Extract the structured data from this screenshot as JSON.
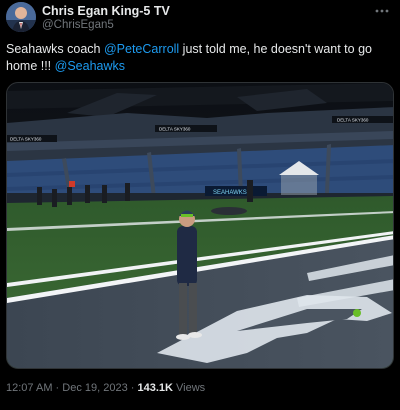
{
  "header": {
    "display_name": "Chris Egan King-5 TV",
    "handle": "@ChrisEgan5",
    "more_icon": "ellipsis-icon"
  },
  "tweet": {
    "text_start": "Seahawks coach ",
    "mention": "@PeteCarroll",
    "text_middle": " just told me, he doesn't want to go home !!! ",
    "hashtag": "@Seahawks"
  },
  "media": {
    "banner_1": "DELTA SKY360",
    "banner_2": "DELTA SKY360",
    "banner_3": "DELTA SKY360",
    "banner_4": "DELTA",
    "sideline_sign": "SEAHAWKS"
  },
  "meta": {
    "time": "12:07 AM",
    "separator": " · ",
    "date": "Dec 19, 2023",
    "views_count": "143.1K",
    "views_label": " Views"
  },
  "colors": {
    "link": "#1d9bf0",
    "muted": "#71767b",
    "text": "#e7e9ea",
    "background": "#000000"
  }
}
